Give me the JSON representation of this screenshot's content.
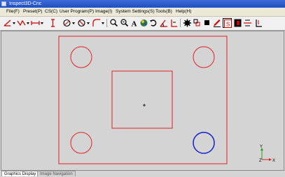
{
  "window": {
    "title": "Inspect3D-Cnc"
  },
  "menu": [
    "File(F)",
    "Preset(P)",
    "CS(C)",
    "User Program(P)",
    "Image(I)",
    "System Settings(S)",
    "Tools(B)",
    "Help(H)"
  ],
  "toolbar": {
    "buttons": [
      "line-tool-icon",
      "polyline-tool-icon",
      "distance-tool-icon",
      "text-caret-icon",
      "circle-tool-icon",
      "no-entry-icon",
      "arc-tool-icon",
      "zoom-in-icon",
      "zoom-out-icon",
      "text-a-icon",
      "color-picker-icon",
      "rotate-icon",
      "angle-tool-icon",
      "axis-tool-icon",
      "settings-gear-icon",
      "fit-icon",
      "solid-square-icon",
      "pen-icon",
      "s-mark-icon",
      "black-square-icon",
      "align-icon",
      "origin-icon"
    ]
  },
  "canvas": {
    "outline_color": "#e02020",
    "selected_color": "#1020d0",
    "axis": {
      "y_label": "Y",
      "x_label": "X",
      "z_label": "Z"
    }
  },
  "tabs": [
    "Graphics Display",
    "Image Navigation"
  ]
}
